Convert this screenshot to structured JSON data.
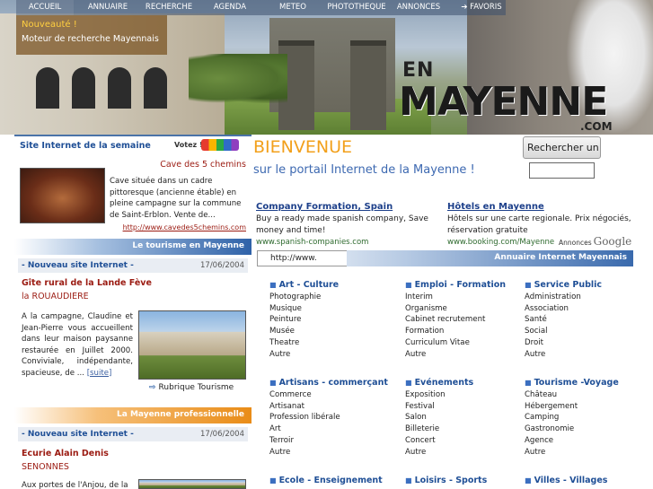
{
  "nav": {
    "items": [
      "ACCUEIL",
      "ANNUAIRE",
      "RECHERCHE",
      "AGENDA",
      "METEO",
      "PHOTOTHEQUE",
      "ANNONCES",
      "FAVORIS"
    ],
    "active": "ACCUEIL",
    "favoris_icon": "arrow-icon"
  },
  "news": {
    "title": "Nouveauté !",
    "text": "Moteur de recherche Mayennais"
  },
  "logo": {
    "en": "EN",
    "mayenne": "MAYENNE",
    "com": ".COM"
  },
  "site_semaine": {
    "title": "Site Internet de la semaine",
    "votez": "Votez !",
    "name": "Cave des 5 chemins",
    "desc": "Cave située dans un cadre pittoresque (ancienne étable) en pleine campagne sur la commune de Saint-Erblon. Vente de...",
    "link": "http://www.cavedes5chemins.com"
  },
  "tourisme": {
    "band": "Le tourisme en Mayenne",
    "header": "- Nouveau site Internet -",
    "date": "17/06/2004",
    "title": "Gîte rural de la Lande Fève",
    "place": "la ROUAUDIERE",
    "desc": "A la campagne, Claudine et Jean-Pierre vous accueillent dans leur maison paysanne restaurée en Juillet 2000. Conviviale, indépendante, spacieuse, de ...",
    "more": "[suite]",
    "rubrique": "Rubrique Tourisme"
  },
  "pro": {
    "band": "La Mayenne professionnelle",
    "header": "- Nouveau site Internet -",
    "date": "17/06/2004",
    "title": "Ecurie Alain Denis",
    "place": "SENONNES",
    "desc": "Aux portes de l'Anjou, de la"
  },
  "welcome": {
    "title": "BIENVENUE",
    "subtitle": "sur le portail Internet de la Mayenne !"
  },
  "search": {
    "button": "Rechercher un site",
    "placeholder": ""
  },
  "ads": [
    {
      "title": "Company Formation, Spain",
      "text": "Buy a ready made spanish company, Save money and time!",
      "url": "www.spanish-companies.com"
    },
    {
      "title": "Hôtels en Mayenne",
      "text": "Hôtels sur une carte regionale. Prix négociés, réservation gratuite",
      "url": "www.booking.com/Mayenne"
    }
  ],
  "google": {
    "label": "Annonces",
    "brand": "Google"
  },
  "annuaire": {
    "band": "Annuaire Internet Mayennais",
    "url": "http://www."
  },
  "categories": [
    {
      "title": "Art - Culture",
      "items": [
        "Photographie",
        "Musique",
        "Peinture",
        "Musée",
        "Theatre",
        "Autre"
      ]
    },
    {
      "title": "Emploi - Formation",
      "items": [
        "Interim",
        "Organisme",
        "Cabinet recrutement",
        "Formation",
        "Curriculum Vitae",
        "Autre"
      ]
    },
    {
      "title": "Service Public",
      "items": [
        "Administration",
        "Association",
        "Santé",
        "Social",
        "Droit",
        "Autre"
      ]
    },
    {
      "title": "Artisans - commerçant",
      "items": [
        "Commerce",
        "Artisanat",
        "Profession libérale",
        "Art",
        "Terroir",
        "Autre"
      ]
    },
    {
      "title": "Evénements",
      "items": [
        "Exposition",
        "Festival",
        "Salon",
        "Billeterie",
        "Concert",
        "Autre"
      ]
    },
    {
      "title": "Tourisme -Voyage",
      "items": [
        "Château",
        "Hébergement",
        "Camping",
        "Gastronomie",
        "Agence",
        "Autre"
      ]
    },
    {
      "title": "Ecole - Enseignement",
      "items": []
    },
    {
      "title": "Loisirs - Sports",
      "items": []
    },
    {
      "title": "Villes - Villages",
      "items": []
    }
  ]
}
